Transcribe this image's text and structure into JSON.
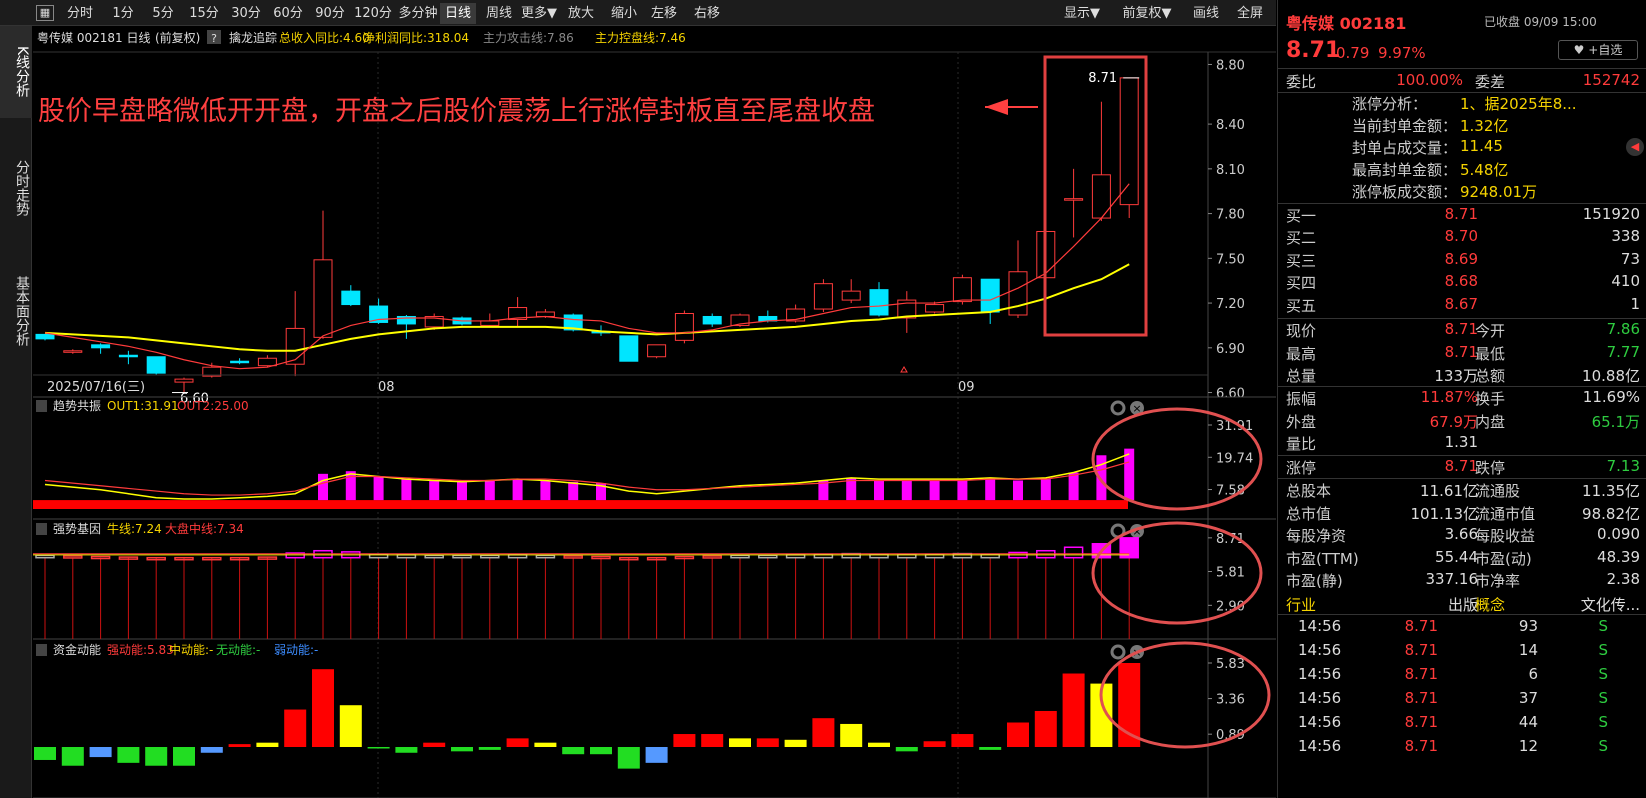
{
  "toolbar": {
    "items": [
      "分时",
      "1分",
      "5分",
      "15分",
      "30分",
      "60分",
      "90分",
      "120分",
      "多分钟",
      "日线",
      "周线",
      "更多▼",
      "放大",
      "缩小",
      "左移",
      "右移"
    ],
    "selected": "日线",
    "right": [
      "显示▼",
      "前复权▼",
      "画线",
      "全屏"
    ],
    "menu_icon": "grid-icon"
  },
  "left_tabs": [
    "K线分析",
    "分时走势",
    "基本面分析"
  ],
  "main": {
    "header": {
      "name": "粤传媒 002181 日线",
      "adj": "(前复权)",
      "help": "?",
      "indicator": "擒龙追踪",
      "items": [
        {
          "t": "总收入同比:4.60",
          "c": "#f5d300"
        },
        {
          "t": "净利润同比:318.04",
          "c": "#f5d300"
        },
        {
          "t": "主力攻击线:7.86",
          "c": "#888888"
        },
        {
          "t": "主力控盘线:7.46",
          "c": "#f5d300"
        }
      ]
    },
    "annotation": "股价早盘略微低开开盘，开盘之后股价震荡上行涨停封板直至尾盘收盘",
    "low_label": "6.60",
    "high_label": "8.71",
    "date_labels": [
      "2025/07/16(三)",
      "08",
      "09"
    ],
    "y_labels": [
      "8.80",
      "8.40",
      "8.10",
      "7.80",
      "7.50",
      "7.20",
      "6.90",
      "6.60"
    ]
  },
  "panels": [
    {
      "title": "趋势共振",
      "items": [
        {
          "t": "OUT1:31.91",
          "c": "#f5d300"
        },
        {
          "t": "OUT2:25.00",
          "c": "#ff3b3b"
        }
      ],
      "y_labels": [
        "31.91",
        "19.74",
        "7.58"
      ]
    },
    {
      "title": "强势基因",
      "items": [
        {
          "t": "牛线:7.24",
          "c": "#f5d300"
        },
        {
          "t": "大盘中线:7.34",
          "c": "#ff3b3b"
        }
      ],
      "y_labels": [
        "8.71",
        "5.81",
        "2.90"
      ]
    },
    {
      "title": "资金动能",
      "items": [
        {
          "t": "强动能:5.83",
          "c": "#ff3b3b"
        },
        {
          "t": "中动能:-",
          "c": "#f5d300"
        },
        {
          "t": "无动能:-",
          "c": "#2ecc40"
        },
        {
          "t": "弱动能:-",
          "c": "#3c8cff"
        }
      ],
      "y_labels": [
        "5.83",
        "3.36",
        "0.89"
      ]
    }
  ],
  "chart_data": {
    "type": "candlestick",
    "candles": [
      [
        6.99,
        6.96,
        6.99,
        6.95
      ],
      [
        6.88,
        6.88,
        6.89,
        6.86
      ],
      [
        6.92,
        6.9,
        6.93,
        6.86
      ],
      [
        6.85,
        6.84,
        6.88,
        6.79
      ],
      [
        6.84,
        6.73,
        6.84,
        6.72
      ],
      [
        6.67,
        6.69,
        6.7,
        6.6
      ],
      [
        6.71,
        6.77,
        6.8,
        6.7
      ],
      [
        6.81,
        6.8,
        6.83,
        6.79
      ],
      [
        6.78,
        6.83,
        6.85,
        6.77
      ],
      [
        6.79,
        7.03,
        7.28,
        6.71
      ],
      [
        6.97,
        7.49,
        7.82,
        6.96
      ],
      [
        7.28,
        7.19,
        7.32,
        7.18
      ],
      [
        7.18,
        7.07,
        7.23,
        7.06
      ],
      [
        7.11,
        7.06,
        7.12,
        6.96
      ],
      [
        7.04,
        7.11,
        7.13,
        7.02
      ],
      [
        7.1,
        7.06,
        7.11,
        7.05
      ],
      [
        7.05,
        7.08,
        7.13,
        7.04
      ],
      [
        7.09,
        7.17,
        7.24,
        7.04
      ],
      [
        7.11,
        7.14,
        7.16,
        7.1
      ],
      [
        7.12,
        7.02,
        7.13,
        7.01
      ],
      [
        7.01,
        7.0,
        7.05,
        6.98
      ],
      [
        6.98,
        6.81,
        6.98,
        6.81
      ],
      [
        6.84,
        6.92,
        6.92,
        6.83
      ],
      [
        6.95,
        7.13,
        7.15,
        6.93
      ],
      [
        7.11,
        7.06,
        7.13,
        7.04
      ],
      [
        7.05,
        7.12,
        7.13,
        7.04
      ],
      [
        7.11,
        7.08,
        7.15,
        7.07
      ],
      [
        7.08,
        7.16,
        7.19,
        7.07
      ],
      [
        7.16,
        7.33,
        7.36,
        7.14
      ],
      [
        7.22,
        7.28,
        7.36,
        7.2
      ],
      [
        7.29,
        7.12,
        7.34,
        7.11
      ],
      [
        7.1,
        7.22,
        7.28,
        7.0
      ],
      [
        7.14,
        7.19,
        7.21,
        7.13
      ],
      [
        7.21,
        7.37,
        7.39,
        7.19
      ],
      [
        7.36,
        7.14,
        7.36,
        7.06
      ],
      [
        7.12,
        7.41,
        7.62,
        7.1
      ],
      [
        7.37,
        7.68,
        7.77,
        7.36
      ],
      [
        7.9,
        7.9,
        8.1,
        7.64
      ],
      [
        7.77,
        8.06,
        8.55,
        7.75
      ],
      [
        7.86,
        8.71,
        8.71,
        7.77
      ]
    ],
    "ma_red": [
      7.0,
      6.97,
      6.94,
      6.91,
      6.87,
      6.82,
      6.78,
      6.76,
      6.77,
      6.82,
      6.98,
      7.05,
      7.09,
      7.1,
      7.1,
      7.08,
      7.08,
      7.1,
      7.11,
      7.09,
      7.08,
      7.03,
      7.0,
      7.0,
      7.02,
      7.06,
      7.08,
      7.09,
      7.13,
      7.17,
      7.18,
      7.2,
      7.2,
      7.22,
      7.22,
      7.3,
      7.4,
      7.58,
      7.77,
      8.0
    ],
    "ma_yellow": [
      7.0,
      6.99,
      6.98,
      6.97,
      6.95,
      6.93,
      6.91,
      6.89,
      6.88,
      6.88,
      6.92,
      6.96,
      6.99,
      7.01,
      7.03,
      7.04,
      7.04,
      7.04,
      7.04,
      7.03,
      7.01,
      7.0,
      6.99,
      7.0,
      7.01,
      7.02,
      7.03,
      7.04,
      7.06,
      7.08,
      7.09,
      7.11,
      7.12,
      7.13,
      7.14,
      7.18,
      7.23,
      7.3,
      7.36,
      7.46
    ],
    "trend": {
      "bars": [
        7.58,
        7.58,
        7.58,
        7.58,
        7.58,
        7.58,
        7.58,
        7.58,
        7.58,
        7.58,
        13.5,
        14.5,
        12.5,
        11.5,
        11,
        10.5,
        11,
        11.5,
        11,
        10.5,
        10,
        7.58,
        7.58,
        7.58,
        7.58,
        7.58,
        7.58,
        7.58,
        11.0,
        12.0,
        11.0,
        11.0,
        11.0,
        11.0,
        12.0,
        11.0,
        11.5,
        14.0,
        20.5,
        23.0,
        31.91
      ],
      "out1": [
        9.5,
        8.5,
        7.5,
        6,
        4.5,
        4,
        4,
        4.5,
        5,
        6,
        11,
        13.5,
        12.5,
        11.5,
        11,
        10.5,
        11,
        11.5,
        11,
        10,
        9,
        7,
        6,
        7,
        8,
        9,
        9.5,
        10,
        11,
        12,
        11.5,
        11.5,
        11.5,
        11.5,
        12,
        11.5,
        12,
        14,
        17,
        21,
        31.91
      ],
      "out2": [
        11,
        10,
        9,
        8,
        7,
        6,
        5.5,
        5.5,
        6,
        7,
        10,
        12.5,
        12.5,
        12,
        11.5,
        11,
        11,
        11.5,
        11.5,
        11,
        10,
        8.5,
        7.5,
        7.5,
        8,
        8.5,
        9,
        9.5,
        10,
        11,
        11,
        11,
        11,
        11,
        11.5,
        11.5,
        11.5,
        13,
        15,
        18,
        25
      ]
    },
    "gene": {
      "boxes": [
        7.2,
        7.15,
        7.1,
        7.05,
        7.0,
        7.0,
        7.0,
        7.0,
        7.05,
        7.4,
        7.6,
        7.5,
        7.3,
        7.25,
        7.2,
        7.2,
        7.2,
        7.25,
        7.2,
        7.15,
        7.1,
        7.0,
        7.0,
        7.1,
        7.15,
        7.2,
        7.2,
        7.25,
        7.3,
        7.35,
        7.3,
        7.3,
        7.3,
        7.35,
        7.3,
        7.45,
        7.6,
        7.9,
        8.2,
        8.71
      ],
      "bull": 7.24,
      "market": 7.34
    },
    "energy": [
      -0.9,
      -1.3,
      -0.7,
      -1.1,
      -1.3,
      -1.3,
      -0.4,
      0.2,
      0.3,
      2.6,
      5.4,
      2.9,
      -0.1,
      -0.4,
      0.3,
      -0.3,
      -0.2,
      0.6,
      0.3,
      -0.5,
      -0.5,
      -1.5,
      -1.1,
      0.9,
      0.9,
      0.6,
      0.6,
      0.5,
      2.0,
      1.6,
      0.3,
      -0.3,
      0.4,
      0.9,
      -0.2,
      1.7,
      2.5,
      5.1,
      4.4,
      5.83
    ],
    "energy_colors": [
      "#22dd22",
      "#22dd22",
      "#5599ff",
      "#22dd22",
      "#22dd22",
      "#22dd22",
      "#5599ff",
      "#ff0000",
      "#ffff00",
      "#ff0000",
      "#ff0000",
      "#ffff00",
      "#22dd22",
      "#22dd22",
      "#ff0000",
      "#22dd22",
      "#22dd22",
      "#ff0000",
      "#ffff00",
      "#22dd22",
      "#22dd22",
      "#22dd22",
      "#5599ff",
      "#ff0000",
      "#ff0000",
      "#ffff00",
      "#ff0000",
      "#ffff00",
      "#ff0000",
      "#ffff00",
      "#ffff00",
      "#22dd22",
      "#ff0000",
      "#ff0000",
      "#22dd22",
      "#ff0000",
      "#ff0000",
      "#ff0000",
      "#ffff00",
      "#ff0000"
    ]
  },
  "right": {
    "title": "粤传媒 002181",
    "status": "已收盘 09/09 15:00",
    "price": "8.71",
    "change": "0.79",
    "pct": "9.97%",
    "fav": "+自选",
    "weibi": [
      "委比",
      "100.00%",
      "委差",
      "152742"
    ],
    "analysis": [
      [
        "涨停分析：",
        "1、据2025年8..."
      ],
      [
        "当前封单金额：",
        "1.32亿"
      ],
      [
        "封单占成交量：",
        "11.45"
      ],
      [
        "最高封单金额：",
        "5.48亿"
      ],
      [
        "涨停板成交额：",
        "9248.01万"
      ]
    ],
    "buys": [
      [
        "买一",
        "8.71",
        "151920"
      ],
      [
        "买二",
        "8.70",
        "338"
      ],
      [
        "买三",
        "8.69",
        "73"
      ],
      [
        "买四",
        "8.68",
        "410"
      ],
      [
        "买五",
        "8.67",
        "1"
      ]
    ],
    "stats1": [
      [
        "现价",
        "8.71",
        "今开",
        "7.86"
      ],
      [
        "最高",
        "8.71",
        "最低",
        "7.77"
      ],
      [
        "总量",
        "133万",
        "总额",
        "10.88亿"
      ]
    ],
    "stats2": [
      [
        "振幅",
        "11.87%",
        "换手",
        "11.69%"
      ],
      [
        "外盘",
        "67.9万",
        "内盘",
        "65.1万"
      ],
      [
        "量比",
        "1.31",
        "",
        ""
      ]
    ],
    "stats3": [
      [
        "涨停",
        "8.71",
        "跌停",
        "7.13"
      ]
    ],
    "stats4": [
      [
        "总股本",
        "11.61亿",
        "流通股",
        "11.35亿"
      ],
      [
        "总市值",
        "101.13亿",
        "流通市值",
        "98.82亿"
      ],
      [
        "每股净资",
        "3.66",
        "每股收益",
        "0.090"
      ],
      [
        "市盈(TTM)",
        "55.44",
        "市盈(动)",
        "48.39"
      ],
      [
        "市盈(静)",
        "337.16",
        "市净率",
        "2.38"
      ]
    ],
    "industry": [
      "行业",
      "出版",
      "概念",
      "文化传..."
    ],
    "ticks": [
      [
        "14:56",
        "8.71",
        "93",
        "S"
      ],
      [
        "14:56",
        "8.71",
        "14",
        "S"
      ],
      [
        "14:56",
        "8.71",
        "6",
        "S"
      ],
      [
        "14:56",
        "8.71",
        "37",
        "S"
      ],
      [
        "14:56",
        "8.71",
        "44",
        "S"
      ],
      [
        "14:56",
        "8.71",
        "12",
        "S"
      ]
    ]
  }
}
